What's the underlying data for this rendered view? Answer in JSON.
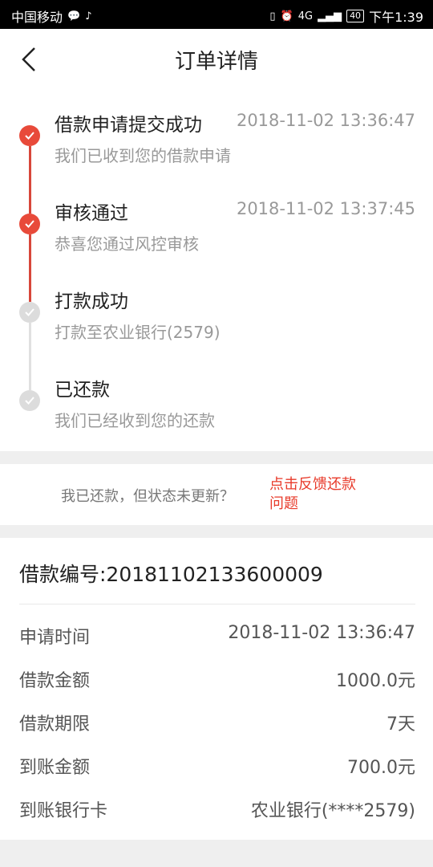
{
  "status_bar": {
    "carrier": "中国移动",
    "network": "4G",
    "battery": "40",
    "time": "下午1:39"
  },
  "nav": {
    "title": "订单详情"
  },
  "timeline": [
    {
      "title": "借款申请提交成功",
      "time": "2018-11-02 13:36:47",
      "desc": "我们已收到您的借款申请",
      "done": true
    },
    {
      "title": "审核通过",
      "time": "2018-11-02 13:37:45",
      "desc": "恭喜您通过风控审核",
      "done": true
    },
    {
      "title": "打款成功",
      "time": "",
      "desc": "打款至农业银行(2579)",
      "done": false
    },
    {
      "title": "已还款",
      "time": "",
      "desc": "我们已经收到您的还款",
      "done": false
    }
  ],
  "feedback": {
    "question": "我已还款，但状态未更新？",
    "link_line1": "点击反馈还款",
    "link_line2": "问题"
  },
  "loan": {
    "number_text": "借款编号:20181102133600009",
    "rows": [
      {
        "label": "申请时间",
        "value": "2018-11-02 13:36:47"
      },
      {
        "label": "借款金额",
        "value": "1000.0元"
      },
      {
        "label": "借款期限",
        "value": "7天"
      },
      {
        "label": "到账金额",
        "value": "700.0元"
      },
      {
        "label": "到账银行卡",
        "value": "农业银行(****2579)"
      }
    ]
  },
  "colors": {
    "accent": "#e84a3a",
    "pending": "#dcdcdc",
    "link": "#e83a2a"
  }
}
